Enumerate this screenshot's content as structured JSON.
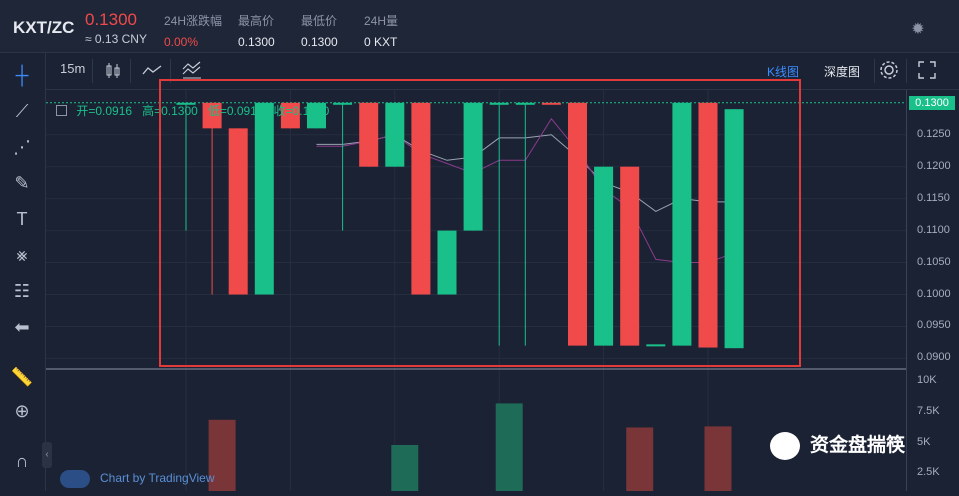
{
  "header": {
    "pair": "KXT/ZC",
    "price": "0.1300",
    "price_cny": "≈ 0.13 CNY",
    "stats": [
      {
        "label": "24H涨跌幅",
        "value": "0.00%"
      },
      {
        "label": "最高价",
        "value": "0.1300"
      },
      {
        "label": "最低价",
        "value": "0.1300"
      },
      {
        "label": "24H量",
        "value": "0 KXT"
      }
    ]
  },
  "toolbar": {
    "interval": "15m",
    "kline_label": "K线图",
    "depth_label": "深度图"
  },
  "legend": {
    "open": "开=0.0916",
    "high": "高=0.1300",
    "low": "低=0.0916",
    "close": "收=0.1300"
  },
  "price_axis": {
    "current": "0.1300",
    "ticks": [
      "0.1250",
      "0.1200",
      "0.1150",
      "0.1100",
      "0.1050",
      "0.1000",
      "0.0950",
      "0.0900"
    ],
    "volume_ticks": [
      "10K",
      "7.5K",
      "5K",
      "2.5K"
    ]
  },
  "branding": {
    "tradingview": "Chart by TradingView",
    "watermark": "资金盘揣筷"
  },
  "colors": {
    "up": "#19c08a",
    "down": "#f04a4a",
    "background": "#1b2233",
    "highlight_box": "#e23a3a"
  },
  "chart_data": {
    "type": "candlestick",
    "ylim": [
      0.0885,
      0.132
    ],
    "candles": [
      {
        "o": 0.13,
        "h": 0.13,
        "l": 0.11,
        "c": 0.13
      },
      {
        "o": 0.13,
        "h": 0.13,
        "l": 0.1,
        "c": 0.126
      },
      {
        "o": 0.126,
        "h": 0.126,
        "l": 0.1,
        "c": 0.1
      },
      {
        "o": 0.1,
        "h": 0.13,
        "l": 0.1,
        "c": 0.13
      },
      {
        "o": 0.13,
        "h": 0.13,
        "l": 0.126,
        "c": 0.126
      },
      {
        "o": 0.126,
        "h": 0.13,
        "l": 0.126,
        "c": 0.13
      },
      {
        "o": 0.13,
        "h": 0.13,
        "l": 0.11,
        "c": 0.13
      },
      {
        "o": 0.13,
        "h": 0.13,
        "l": 0.12,
        "c": 0.12
      },
      {
        "o": 0.12,
        "h": 0.13,
        "l": 0.12,
        "c": 0.13
      },
      {
        "o": 0.13,
        "h": 0.13,
        "l": 0.1,
        "c": 0.1
      },
      {
        "o": 0.1,
        "h": 0.11,
        "l": 0.1,
        "c": 0.11
      },
      {
        "o": 0.11,
        "h": 0.13,
        "l": 0.11,
        "c": 0.13
      },
      {
        "o": 0.13,
        "h": 0.13,
        "l": 0.092,
        "c": 0.13
      },
      {
        "o": 0.13,
        "h": 0.13,
        "l": 0.092,
        "c": 0.13
      },
      {
        "o": 0.13,
        "h": 0.13,
        "l": 0.13,
        "c": 0.1298
      },
      {
        "o": 0.13,
        "h": 0.13,
        "l": 0.092,
        "c": 0.092
      },
      {
        "o": 0.092,
        "h": 0.12,
        "l": 0.092,
        "c": 0.12
      },
      {
        "o": 0.12,
        "h": 0.12,
        "l": 0.092,
        "c": 0.092
      },
      {
        "o": 0.092,
        "h": 0.092,
        "l": 0.092,
        "c": 0.0922
      },
      {
        "o": 0.092,
        "h": 0.13,
        "l": 0.092,
        "c": 0.13
      },
      {
        "o": 0.13,
        "h": 0.13,
        "l": 0.0917,
        "c": 0.0917
      },
      {
        "o": 0.0916,
        "h": 0.129,
        "l": 0.0916,
        "c": 0.129
      }
    ],
    "ma_white": [
      null,
      null,
      null,
      null,
      null,
      0.1235,
      0.1235,
      0.124,
      0.125,
      0.1225,
      0.121,
      0.1215,
      0.1245,
      0.1245,
      0.125,
      0.1215,
      0.1175,
      0.116,
      0.113,
      0.115,
      0.1145,
      0.1145
    ],
    "ma_purple": [
      null,
      null,
      null,
      null,
      null,
      0.1232,
      0.1232,
      0.124,
      0.125,
      0.122,
      0.1205,
      0.119,
      0.121,
      0.121,
      0.1275,
      0.1225,
      0.1165,
      0.1135,
      0.1055,
      0.105,
      0.105,
      0.1065
    ],
    "volumes": [
      0,
      6500,
      0,
      0,
      0,
      0,
      0,
      0,
      4200,
      0,
      0,
      0,
      8000,
      0,
      0,
      0,
      0,
      5800,
      0,
      0,
      5900,
      0
    ]
  }
}
